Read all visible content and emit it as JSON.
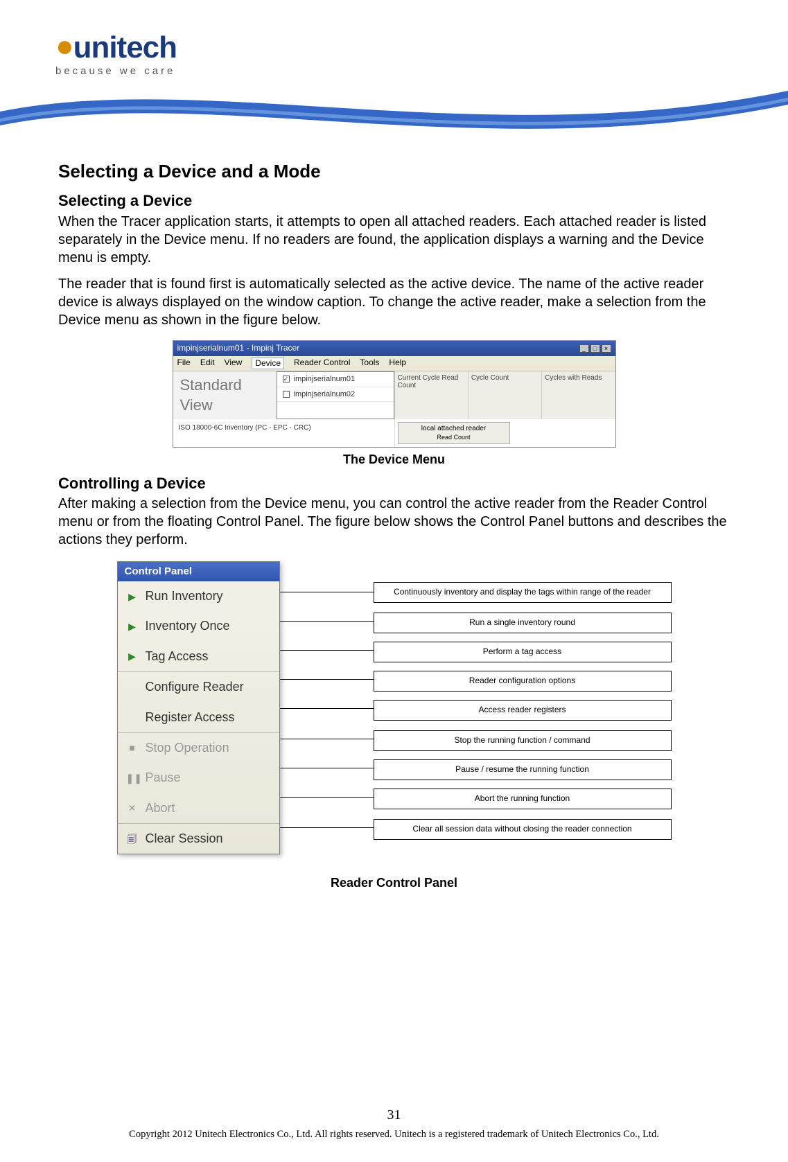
{
  "brand": {
    "name": "unitech",
    "tagline": "because we care"
  },
  "headings": {
    "h1": "Selecting a Device and a Mode",
    "h2a": "Selecting a Device",
    "h2b": "Controlling a Device"
  },
  "paragraphs": {
    "p1": "When the Tracer application starts, it attempts to open all attached readers. Each attached reader is listed separately in the Device menu. If no readers are found, the application displays a warning and the Device menu is empty.",
    "p2": "The reader that is found first is automatically selected as the active device. The name of the active reader device is always displayed on the window caption. To change the active reader, make a selection from the Device menu as shown in the figure below.",
    "p3": "After making a selection from the Device menu, you can control the active reader from the Reader Control menu or from the floating Control Panel. The figure below shows the Control Panel buttons and describes the actions they perform."
  },
  "captions": {
    "fig1": "The Device Menu",
    "fig2": "Reader Control Panel"
  },
  "scr1": {
    "title": "impinjserialnum01 - Impinj Tracer",
    "menus": [
      "File",
      "Edit",
      "View",
      "Device",
      "Reader Control",
      "Tools",
      "Help"
    ],
    "big_label": "Standard View",
    "dropdown": [
      "impinjserialnum01",
      "impinjserialnum02"
    ],
    "iso_label": "ISO 18000-6C Inventory (PC - EPC - CRC)",
    "extra_btn": "local attached reader",
    "read_count": "Read Count",
    "headers": [
      "Current Cycle Read Count",
      "Cycle Count",
      "Cycles with Reads"
    ]
  },
  "scr2": {
    "panel_title": "Control Panel",
    "items": [
      {
        "label": "Run Inventory",
        "glyph": "▶",
        "gclass": "play",
        "disabled": false
      },
      {
        "label": "Inventory Once",
        "glyph": "▶",
        "gclass": "play",
        "disabled": false
      },
      {
        "label": "Tag Access",
        "glyph": "▶",
        "gclass": "play",
        "disabled": false
      },
      {
        "label": "Configure Reader",
        "glyph": "",
        "gclass": "",
        "disabled": false
      },
      {
        "label": "Register Access",
        "glyph": "",
        "gclass": "",
        "disabled": false
      },
      {
        "label": "Stop Operation",
        "glyph": "■",
        "gclass": "stop",
        "disabled": true
      },
      {
        "label": "Pause",
        "glyph": "❚❚",
        "gclass": "pause",
        "disabled": true
      },
      {
        "label": "Abort",
        "glyph": "✕",
        "gclass": "abort",
        "disabled": true
      },
      {
        "label": "Clear Session",
        "glyph": "🗐",
        "gclass": "clear",
        "disabled": false
      }
    ],
    "descriptions": [
      "Continuously inventory and display the tags within range of the reader",
      "Run a single inventory round",
      "Perform a tag access",
      "Reader configuration options",
      "Access reader registers",
      "Stop the running function / command",
      "Pause / resume the running function",
      "Abort the running function",
      "Clear all session data without closing the reader connection"
    ]
  },
  "footer": {
    "page": "31",
    "copyright": "Copyright 2012 Unitech Electronics Co., Ltd. All rights reserved. Unitech is a registered trademark of Unitech Electronics Co., Ltd."
  }
}
